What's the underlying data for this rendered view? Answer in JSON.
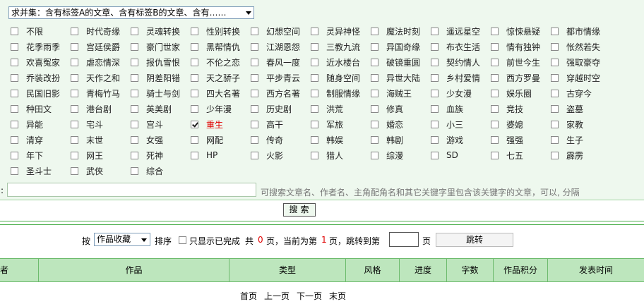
{
  "filter": {
    "mode_select_value": "求并集：含有标签A的文章、含有标签B的文章、含有……",
    "tags": [
      {
        "label": "不限",
        "checked": false
      },
      {
        "label": "时代奇缘",
        "checked": false
      },
      {
        "label": "灵魂转换",
        "checked": false
      },
      {
        "label": "性别转换",
        "checked": false
      },
      {
        "label": "幻想空间",
        "checked": false
      },
      {
        "label": "灵异神怪",
        "checked": false
      },
      {
        "label": "魔法时刻",
        "checked": false
      },
      {
        "label": "遥远星空",
        "checked": false
      },
      {
        "label": "惊悚悬疑",
        "checked": false
      },
      {
        "label": "都市情缘",
        "checked": false
      },
      {
        "label": "花季雨季",
        "checked": false
      },
      {
        "label": "宫廷侯爵",
        "checked": false
      },
      {
        "label": "豪门世家",
        "checked": false
      },
      {
        "label": "黑帮情仇",
        "checked": false
      },
      {
        "label": "江湖恩怨",
        "checked": false
      },
      {
        "label": "三教九流",
        "checked": false
      },
      {
        "label": "异国奇缘",
        "checked": false
      },
      {
        "label": "布衣生活",
        "checked": false
      },
      {
        "label": "情有独钟",
        "checked": false
      },
      {
        "label": "怅然若失",
        "checked": false
      },
      {
        "label": "欢喜冤家",
        "checked": false
      },
      {
        "label": "虐恋情深",
        "checked": false
      },
      {
        "label": "报仇雪恨",
        "checked": false
      },
      {
        "label": "不伦之恋",
        "checked": false
      },
      {
        "label": "春风一度",
        "checked": false
      },
      {
        "label": "近水楼台",
        "checked": false
      },
      {
        "label": "破镜重圆",
        "checked": false
      },
      {
        "label": "契约情人",
        "checked": false
      },
      {
        "label": "前世今生",
        "checked": false
      },
      {
        "label": "强取豪夺",
        "checked": false
      },
      {
        "label": "乔装改扮",
        "checked": false
      },
      {
        "label": "天作之和",
        "checked": false
      },
      {
        "label": "阴差阳错",
        "checked": false
      },
      {
        "label": "天之骄子",
        "checked": false
      },
      {
        "label": "平步青云",
        "checked": false
      },
      {
        "label": "随身空间",
        "checked": false
      },
      {
        "label": "异世大陆",
        "checked": false
      },
      {
        "label": "乡村爱情",
        "checked": false
      },
      {
        "label": "西方罗曼",
        "checked": false
      },
      {
        "label": "穿越时空",
        "checked": false
      },
      {
        "label": "民国旧影",
        "checked": false
      },
      {
        "label": "青梅竹马",
        "checked": false
      },
      {
        "label": "骑士与剑",
        "checked": false
      },
      {
        "label": "四大名著",
        "checked": false
      },
      {
        "label": "西方名著",
        "checked": false
      },
      {
        "label": "制服情缘",
        "checked": false
      },
      {
        "label": "海贼王",
        "checked": false
      },
      {
        "label": "少女漫",
        "checked": false
      },
      {
        "label": "娱乐圈",
        "checked": false
      },
      {
        "label": "古穿今",
        "checked": false
      },
      {
        "label": "种田文",
        "checked": false
      },
      {
        "label": "港台剧",
        "checked": false
      },
      {
        "label": "英美剧",
        "checked": false
      },
      {
        "label": "少年漫",
        "checked": false
      },
      {
        "label": "历史剧",
        "checked": false
      },
      {
        "label": "洪荒",
        "checked": false
      },
      {
        "label": "修真",
        "checked": false
      },
      {
        "label": "血族",
        "checked": false
      },
      {
        "label": "竞技",
        "checked": false
      },
      {
        "label": "盗墓",
        "checked": false
      },
      {
        "label": "异能",
        "checked": false
      },
      {
        "label": "宅斗",
        "checked": false
      },
      {
        "label": "宫斗",
        "checked": false
      },
      {
        "label": "重生",
        "checked": true
      },
      {
        "label": "高干",
        "checked": false
      },
      {
        "label": "军旅",
        "checked": false
      },
      {
        "label": "婚恋",
        "checked": false
      },
      {
        "label": "小三",
        "checked": false
      },
      {
        "label": "婆媳",
        "checked": false
      },
      {
        "label": "家教",
        "checked": false
      },
      {
        "label": "清穿",
        "checked": false
      },
      {
        "label": "末世",
        "checked": false
      },
      {
        "label": "女强",
        "checked": false
      },
      {
        "label": "网配",
        "checked": false
      },
      {
        "label": "传奇",
        "checked": false
      },
      {
        "label": "韩娱",
        "checked": false
      },
      {
        "label": "韩剧",
        "checked": false
      },
      {
        "label": "游戏",
        "checked": false
      },
      {
        "label": "强强",
        "checked": false
      },
      {
        "label": "生子",
        "checked": false
      },
      {
        "label": "年下",
        "checked": false
      },
      {
        "label": "网王",
        "checked": false
      },
      {
        "label": "死神",
        "checked": false
      },
      {
        "label": "HP",
        "checked": false
      },
      {
        "label": "火影",
        "checked": false
      },
      {
        "label": "猎人",
        "checked": false
      },
      {
        "label": "综漫",
        "checked": false
      },
      {
        "label": "SD",
        "checked": false
      },
      {
        "label": "七五",
        "checked": false
      },
      {
        "label": "霹雳",
        "checked": false
      },
      {
        "label": "圣斗士",
        "checked": false
      },
      {
        "label": "武侠",
        "checked": false
      },
      {
        "label": "综合",
        "checked": false
      }
    ],
    "colon": ":",
    "keyword_value": "",
    "keyword_hint": "可搜索文章名、作者名、主角配角名和其它关键字里包含该关键字的文章，可以, 分隔",
    "search_label": "搜索"
  },
  "sort": {
    "by_label": "按",
    "select_value": "作品收藏",
    "order_label": "排序",
    "only_done_label": "只显示已完成",
    "total_prefix": "共",
    "total_pages": "0",
    "total_suffix": "页，当前为第",
    "current_page": "1",
    "current_suffix": "页，跳转到第",
    "jump_value": "",
    "page_suffix": "页",
    "jump_label": "跳转"
  },
  "table": {
    "columns": [
      "者",
      "作品",
      "类型",
      "风格",
      "进度",
      "字数",
      "作品积分",
      "发表时间"
    ]
  },
  "pager": {
    "first": "首页",
    "prev": "上一页",
    "next": "下一页",
    "last": "末页"
  },
  "colors": {
    "panel_bg": "#eef8ee",
    "header_bg": "#bde6bd",
    "accent_green": "#4caf4c",
    "highlight_red": "#e00000"
  }
}
